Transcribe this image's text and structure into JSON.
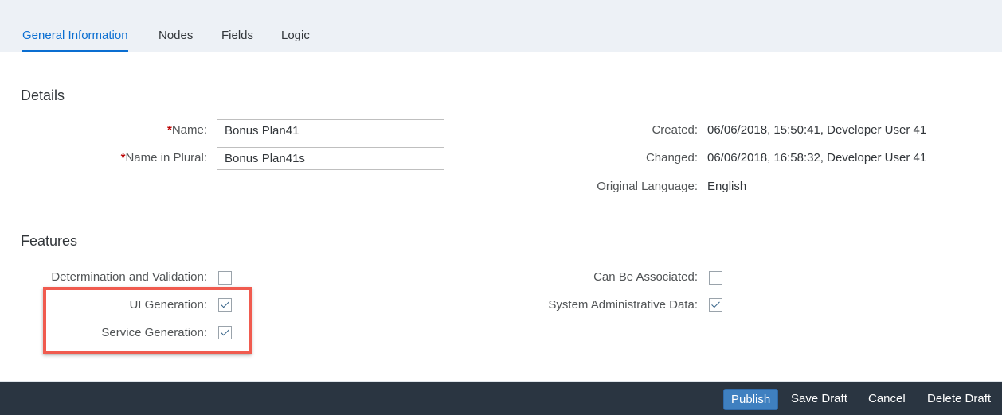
{
  "tabs": [
    {
      "label": "General Information",
      "active": true
    },
    {
      "label": "Nodes",
      "active": false
    },
    {
      "label": "Fields",
      "active": false
    },
    {
      "label": "Logic",
      "active": false
    }
  ],
  "details": {
    "title": "Details",
    "name_label": "Name:",
    "name_value": "Bonus Plan41",
    "plural_label": "Name in Plural:",
    "plural_value": "Bonus Plan41s",
    "required_marker": "*",
    "created_label": "Created:",
    "created_value": "06/06/2018, 15:50:41, Developer User 41",
    "changed_label": "Changed:",
    "changed_value": "06/06/2018, 16:58:32, Developer User 41",
    "language_label": "Original Language:",
    "language_value": "English"
  },
  "features": {
    "title": "Features",
    "items": [
      {
        "label": "Determination and Validation:",
        "checked": false
      },
      {
        "label": "UI Generation:",
        "checked": true
      },
      {
        "label": "Service Generation:",
        "checked": true
      },
      {
        "label": "Can Be Associated:",
        "checked": false
      },
      {
        "label": "System Administrative Data:",
        "checked": true
      }
    ]
  },
  "footer": {
    "publish": "Publish",
    "save_draft": "Save Draft",
    "cancel": "Cancel",
    "delete_draft": "Delete Draft"
  },
  "colors": {
    "accent": "#0a6ed1",
    "highlight": "#f05b4f",
    "footer_bg": "#2a3541",
    "primary_button": "#3f80c0"
  }
}
